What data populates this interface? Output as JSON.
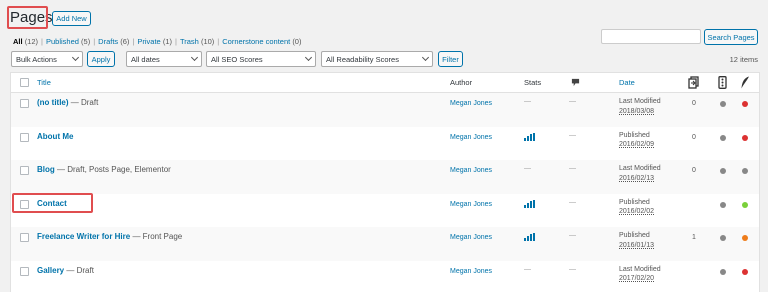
{
  "header": {
    "title": "Pages",
    "add_new_label": "Add New"
  },
  "subsubsub": [
    {
      "label": "All",
      "count": "(12)",
      "current": true
    },
    {
      "label": "Published",
      "count": "(5)"
    },
    {
      "label": "Drafts",
      "count": "(6)"
    },
    {
      "label": "Private",
      "count": "(1)"
    },
    {
      "label": "Trash",
      "count": "(10)"
    },
    {
      "label": "Cornerstone content",
      "count": "(0)"
    }
  ],
  "search": {
    "value": "",
    "button_label": "Search Pages"
  },
  "filters": {
    "bulk_actions": "Bulk Actions",
    "apply_label": "Apply",
    "dates": "All dates",
    "seo": "All SEO Scores",
    "readability": "All Readability Scores",
    "filter_label": "Filter"
  },
  "items_count": "12 items",
  "columns": {
    "title": "Title",
    "author": "Author",
    "stats": "Stats",
    "date": "Date"
  },
  "rows": [
    {
      "title": "(no title)",
      "state": " — Draft",
      "author": "Megan Jones",
      "has_stats": false,
      "stats_dash": "—",
      "comments": "—",
      "date_status": "Last Modified",
      "date": "2018/03/08",
      "links": "0",
      "seo_color": "#888888",
      "read_color": "#dc3232"
    },
    {
      "title": "About Me",
      "state": "",
      "author": "Megan Jones",
      "has_stats": true,
      "stats_dash": "",
      "comments": "—",
      "date_status": "Published",
      "date": "2016/02/09",
      "links": "0",
      "seo_color": "#888888",
      "read_color": "#dc3232"
    },
    {
      "title": "Blog",
      "state": " — Draft, Posts Page, Elementor",
      "author": "Megan Jones",
      "has_stats": false,
      "stats_dash": "—",
      "comments": "—",
      "date_status": "Last Modified",
      "date": "2016/02/13",
      "links": "0",
      "seo_color": "#888888",
      "read_color": "#888888"
    },
    {
      "title": "Contact",
      "state": "",
      "author": "Megan Jones",
      "has_stats": true,
      "stats_dash": "",
      "comments": "—",
      "date_status": "Published",
      "date": "2016/02/02",
      "links": "",
      "seo_color": "#888888",
      "read_color": "#7ad03a"
    },
    {
      "title": "Freelance Writer for Hire",
      "state": " — Front Page",
      "author": "Megan Jones",
      "has_stats": true,
      "stats_dash": "",
      "comments": "—",
      "date_status": "Published",
      "date": "2016/01/13",
      "links": "1",
      "seo_color": "#888888",
      "read_color": "#ee7c1b"
    },
    {
      "title": "Gallery",
      "state": " — Draft",
      "author": "Megan Jones",
      "has_stats": false,
      "stats_dash": "—",
      "comments": "—",
      "date_status": "Last Modified",
      "date": "2017/02/20",
      "links": "",
      "seo_color": "#888888",
      "read_color": "#dc3232"
    }
  ],
  "colors": {
    "accent": "#0073aa",
    "highlight_box": "#e04d4f"
  }
}
